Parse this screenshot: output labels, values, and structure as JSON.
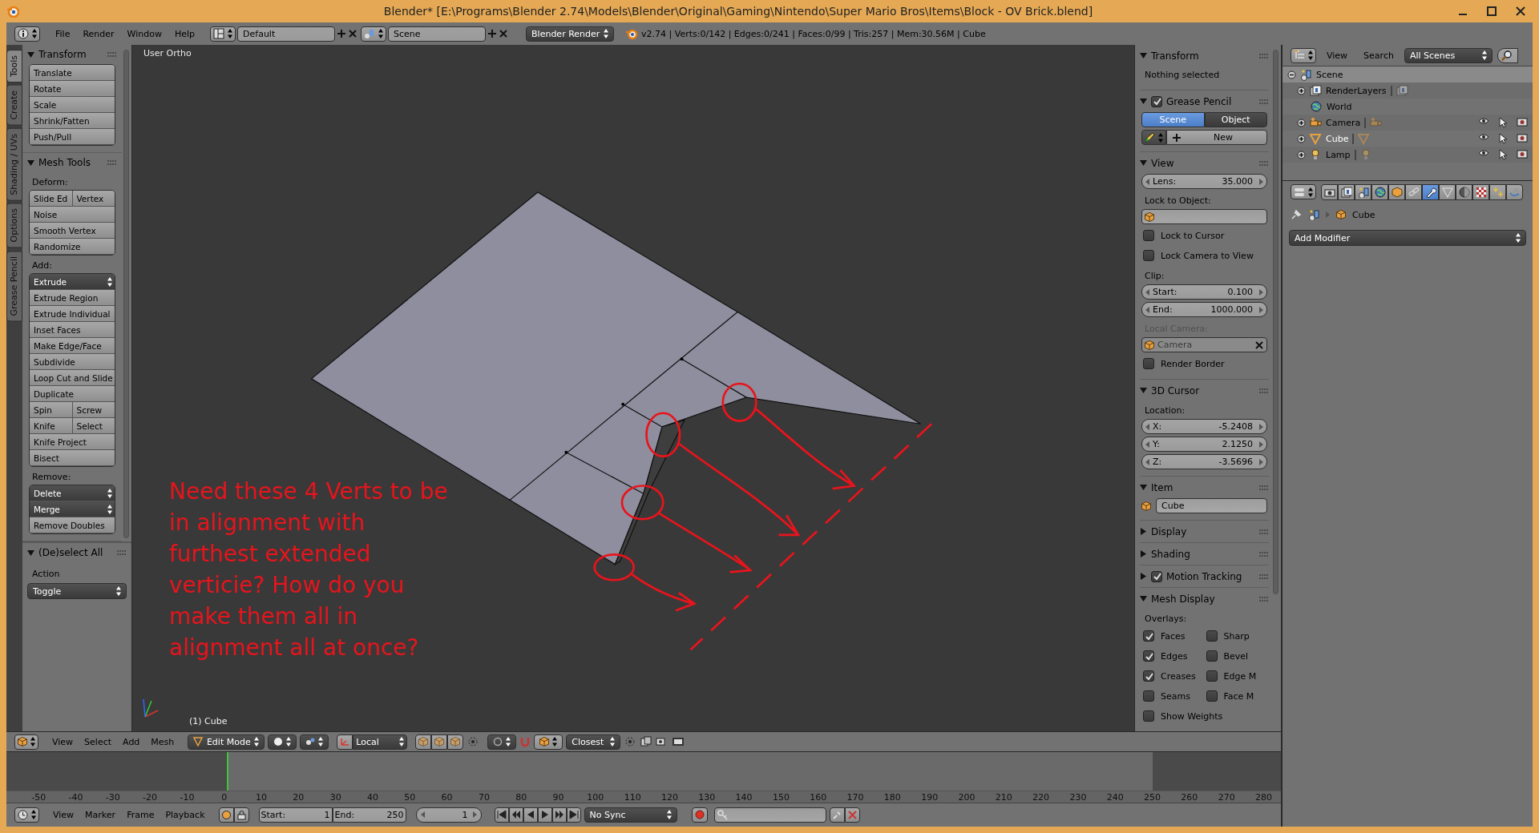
{
  "window": {
    "title": "Blender* [E:\\Programs\\Blender 2.74\\Models\\Blender\\Original\\Gaming\\Nintendo\\Super Mario Bros\\Items\\Block - OV Brick.blend]"
  },
  "info_header": {
    "menus": [
      "File",
      "Render",
      "Window",
      "Help"
    ],
    "screen_layout": "Default",
    "scene": "Scene",
    "render_engine": "Blender Render",
    "stats": "v2.74 | Verts:0/142 | Edges:0/241 | Faces:0/99 | Tris:257 | Mem:30.56M | Cube"
  },
  "tool_shelf": {
    "tabs": [
      {
        "label": "Tools",
        "selected": true
      },
      {
        "label": "Create",
        "selected": false
      },
      {
        "label": "Shading / UVs",
        "selected": false
      },
      {
        "label": "Options",
        "selected": false
      },
      {
        "label": "Grease Pencil",
        "selected": false
      }
    ],
    "panels": [
      {
        "title": "Transform",
        "expanded": true,
        "groups": [
          {
            "rows": [
              [
                {
                  "label": "Translate",
                  "kind": "button"
                }
              ],
              [
                {
                  "label": "Rotate",
                  "kind": "button"
                }
              ],
              [
                {
                  "label": "Scale",
                  "kind": "button"
                }
              ],
              [
                {
                  "label": "Shrink/Fatten",
                  "kind": "button"
                }
              ],
              [
                {
                  "label": "Push/Pull",
                  "kind": "button"
                }
              ]
            ]
          }
        ]
      },
      {
        "title": "Mesh Tools",
        "expanded": true,
        "groups": [
          {
            "label": "Deform:",
            "rows": [
              [
                {
                  "label": "Slide Ed",
                  "kind": "button"
                },
                {
                  "label": "Vertex",
                  "kind": "button"
                }
              ],
              [
                {
                  "label": "Noise",
                  "kind": "button"
                }
              ],
              [
                {
                  "label": "Smooth Vertex",
                  "kind": "button"
                }
              ],
              [
                {
                  "label": "Randomize",
                  "kind": "button"
                }
              ]
            ]
          },
          {
            "label": "Add:",
            "rows": [
              [
                {
                  "label": "Extrude",
                  "kind": "dropdown"
                }
              ],
              [
                {
                  "label": "Extrude Region",
                  "kind": "button"
                }
              ],
              [
                {
                  "label": "Extrude Individual",
                  "kind": "button"
                }
              ],
              [
                {
                  "label": "Inset Faces",
                  "kind": "button"
                }
              ],
              [
                {
                  "label": "Make Edge/Face",
                  "kind": "button"
                }
              ],
              [
                {
                  "label": "Subdivide",
                  "kind": "button"
                }
              ],
              [
                {
                  "label": "Loop Cut and Slide",
                  "kind": "button"
                }
              ],
              [
                {
                  "label": "Duplicate",
                  "kind": "button"
                }
              ],
              [
                {
                  "label": "Spin",
                  "kind": "button"
                },
                {
                  "label": "Screw",
                  "kind": "button"
                }
              ],
              [
                {
                  "label": "Knife",
                  "kind": "button"
                },
                {
                  "label": "Select",
                  "kind": "button"
                }
              ],
              [
                {
                  "label": "Knife Project",
                  "kind": "button"
                }
              ],
              [
                {
                  "label": "Bisect",
                  "kind": "button"
                }
              ]
            ]
          },
          {
            "label": "Remove:",
            "rows": [
              [
                {
                  "label": "Delete",
                  "kind": "dropdown"
                }
              ],
              [
                {
                  "label": "Merge",
                  "kind": "dropdown"
                }
              ],
              [
                {
                  "label": "Remove Doubles",
                  "kind": "button"
                }
              ]
            ]
          }
        ]
      }
    ]
  },
  "operator_panel": {
    "title": "(De)select All",
    "expanded": true,
    "field_label": "Action",
    "value": "Toggle"
  },
  "viewport": {
    "view_name": "User Ortho",
    "object_label": "(1) Cube",
    "note_lines": [
      "Need these 4 Verts to be",
      "in alignment with",
      "furthest extended",
      "verticie? How do you",
      "make them all in",
      "alignment all at once?"
    ]
  },
  "view_header": {
    "menus": [
      "View",
      "Select",
      "Add",
      "Mesh"
    ],
    "mode": "Edit Mode",
    "orientation": "Local",
    "snap_target": "Closest"
  },
  "timeline": {
    "ruler": [
      "-50",
      "-40",
      "-30",
      "-20",
      "-10",
      "0",
      "10",
      "20",
      "30",
      "40",
      "50",
      "60",
      "70",
      "80",
      "90",
      "100",
      "110",
      "120",
      "130",
      "140",
      "150",
      "160",
      "170",
      "180",
      "190",
      "200",
      "210",
      "220",
      "230",
      "240",
      "250",
      "260",
      "270",
      "280"
    ],
    "menus": [
      "View",
      "Marker",
      "Frame",
      "Playback"
    ],
    "start": {
      "label": "Start:",
      "value": "1"
    },
    "end": {
      "label": "End:",
      "value": "250"
    },
    "current_frame": "1",
    "sync": "No Sync"
  },
  "properties_region": {
    "sections": [
      {
        "title": "Transform",
        "expanded": true,
        "items": [
          {
            "kind": "text",
            "text": "Nothing selected"
          }
        ]
      },
      {
        "title": "Grease Pencil",
        "expanded": true,
        "checked": true,
        "items": [
          {
            "kind": "segmented",
            "options": [
              {
                "label": "Scene",
                "selected": true
              },
              {
                "label": "Object",
                "selected": false
              }
            ]
          },
          {
            "kind": "new",
            "label": "New"
          }
        ]
      },
      {
        "title": "View",
        "expanded": true,
        "items": [
          {
            "kind": "number",
            "label": "Lens:",
            "value": "35.000"
          },
          {
            "kind": "label",
            "text": "Lock to Object:",
            "disabled": false
          },
          {
            "kind": "object-field",
            "disabled": false
          },
          {
            "kind": "checkbox",
            "label": "Lock to Cursor",
            "checked": false
          },
          {
            "kind": "checkbox",
            "label": "Lock Camera to View",
            "checked": false
          },
          {
            "kind": "label",
            "text": "Clip:",
            "disabled": false
          },
          {
            "kind": "number",
            "label": "Start:",
            "value": "0.100"
          },
          {
            "kind": "number",
            "label": "End:",
            "value": "1000.000"
          },
          {
            "kind": "label",
            "text": "Local Camera:",
            "disabled": true
          },
          {
            "kind": "object-field",
            "value": "Camera",
            "disabled": true
          },
          {
            "kind": "checkbox",
            "label": "Render Border",
            "checked": false
          }
        ]
      },
      {
        "title": "3D Cursor",
        "expanded": true,
        "items": [
          {
            "kind": "label",
            "text": "Location:",
            "disabled": false
          },
          {
            "kind": "number",
            "label": "X:",
            "value": "-5.2408"
          },
          {
            "kind": "number",
            "label": "Y:",
            "value": "2.1250"
          },
          {
            "kind": "number",
            "label": "Z:",
            "value": "-3.5696"
          }
        ]
      },
      {
        "title": "Item",
        "expanded": true,
        "items": [
          {
            "kind": "name-field",
            "value": "Cube"
          }
        ]
      },
      {
        "title": "Display",
        "expanded": false
      },
      {
        "title": "Shading",
        "expanded": false
      },
      {
        "title": "Motion Tracking",
        "expanded": false,
        "checked": true
      },
      {
        "title": "Mesh Display",
        "expanded": true,
        "items": [
          {
            "kind": "label",
            "text": "Overlays:",
            "disabled": false
          },
          {
            "kind": "checkbox-pair",
            "boxes": [
              {
                "label": "Faces",
                "checked": true
              },
              {
                "label": "Sharp",
                "checked": false
              }
            ]
          },
          {
            "kind": "checkbox-pair",
            "boxes": [
              {
                "label": "Edges",
                "checked": true
              },
              {
                "label": "Bevel",
                "checked": false
              }
            ]
          },
          {
            "kind": "checkbox-pair",
            "boxes": [
              {
                "label": "Creases",
                "checked": true
              },
              {
                "label": "Edge M",
                "checked": false
              }
            ]
          },
          {
            "kind": "checkbox-pair",
            "boxes": [
              {
                "label": "Seams",
                "checked": false
              },
              {
                "label": "Face M",
                "checked": false
              }
            ]
          },
          {
            "kind": "checkbox",
            "label": "Show Weights",
            "checked": false
          }
        ]
      }
    ]
  },
  "outliner": {
    "menus": [
      "View",
      "Search"
    ],
    "filter": "All Scenes",
    "tree": [
      {
        "name": "Scene",
        "kind": "scene",
        "expanded": true,
        "selected": true,
        "active": false,
        "children": [
          {
            "name": "RenderLayers",
            "kind": "renderlayers",
            "expanded": false,
            "selected": false,
            "active": false
          },
          {
            "name": "World",
            "kind": "world",
            "selected": false,
            "active": false
          },
          {
            "name": "Camera",
            "kind": "camera",
            "expanded": false,
            "selected": false,
            "active": false
          },
          {
            "name": "Cube",
            "kind": "mesh",
            "expanded": false,
            "selected": false,
            "active": true
          },
          {
            "name": "Lamp",
            "kind": "lamp",
            "expanded": false,
            "selected": false,
            "active": false
          }
        ]
      }
    ]
  },
  "properties_editor": {
    "tabs": [
      {
        "kind": "render",
        "selected": false
      },
      {
        "kind": "layers",
        "selected": false
      },
      {
        "kind": "scene",
        "selected": false
      },
      {
        "kind": "world",
        "selected": false
      },
      {
        "kind": "object",
        "selected": false
      },
      {
        "kind": "constraints",
        "selected": false
      },
      {
        "kind": "modifiers",
        "selected": true
      },
      {
        "kind": "data",
        "selected": false
      },
      {
        "kind": "material",
        "selected": false
      },
      {
        "kind": "texture",
        "selected": false
      },
      {
        "kind": "particles",
        "selected": false
      },
      {
        "kind": "physics",
        "selected": false
      }
    ],
    "breadcrumb": "Cube",
    "add_modifier": "Add Modifier"
  }
}
